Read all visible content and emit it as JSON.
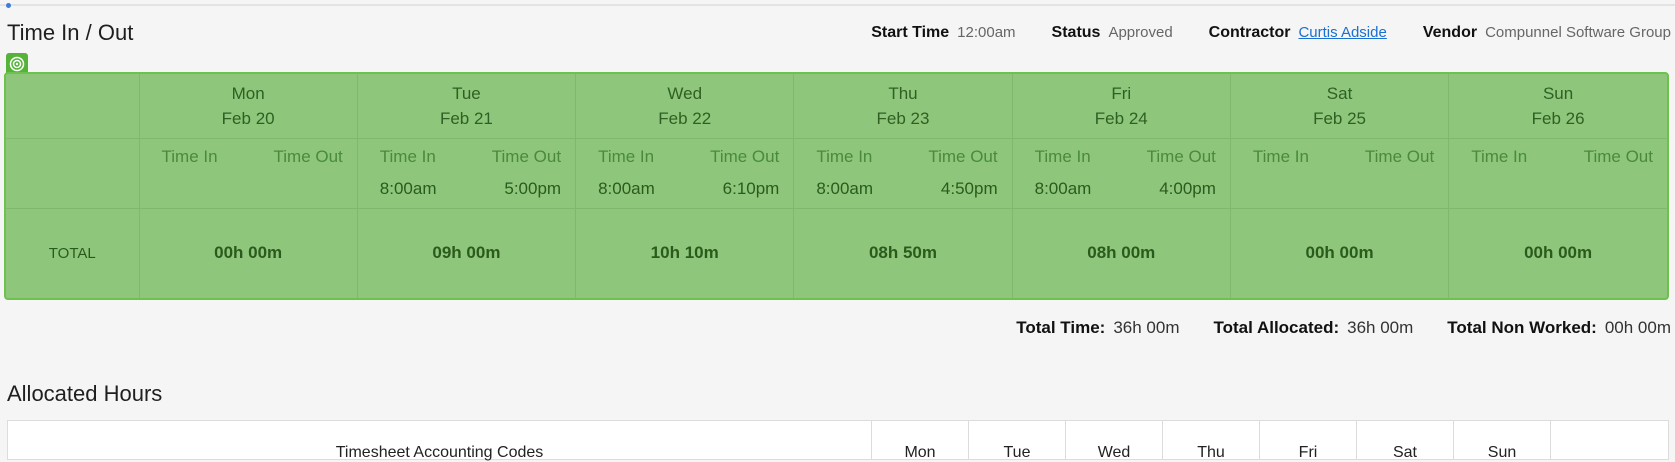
{
  "header": {
    "title": "Time In / Out",
    "meta": [
      {
        "label": "Start Time",
        "value": "12:00am"
      },
      {
        "label": "Status",
        "value": "Approved"
      },
      {
        "label": "Contractor",
        "value": "Curtis Adside"
      },
      {
        "label": "Vendor",
        "value": "Compunnel Software Group"
      }
    ]
  },
  "grid": {
    "time_in_label": "Time In",
    "time_out_label": "Time Out",
    "total_label": "TOTAL",
    "days": [
      {
        "name": "Mon",
        "date": "Feb 20",
        "time_in": "",
        "time_out": "",
        "total": "00h 00m"
      },
      {
        "name": "Tue",
        "date": "Feb 21",
        "time_in": "8:00am",
        "time_out": "5:00pm",
        "total": "09h 00m"
      },
      {
        "name": "Wed",
        "date": "Feb 22",
        "time_in": "8:00am",
        "time_out": "6:10pm",
        "total": "10h 10m"
      },
      {
        "name": "Thu",
        "date": "Feb 23",
        "time_in": "8:00am",
        "time_out": "4:50pm",
        "total": "08h 50m"
      },
      {
        "name": "Fri",
        "date": "Feb 24",
        "time_in": "8:00am",
        "time_out": "4:00pm",
        "total": "08h 00m"
      },
      {
        "name": "Sat",
        "date": "Feb 25",
        "time_in": "",
        "time_out": "",
        "total": "00h 00m"
      },
      {
        "name": "Sun",
        "date": "Feb 26",
        "time_in": "",
        "time_out": "",
        "total": "00h 00m"
      }
    ]
  },
  "totals": [
    {
      "label": "Total Time:",
      "value": "36h 00m"
    },
    {
      "label": "Total Allocated:",
      "value": "36h 00m"
    },
    {
      "label": "Total Non Worked:",
      "value": "00h 00m"
    }
  ],
  "allocated": {
    "title": "Allocated Hours",
    "columns": [
      "Timesheet Accounting Codes",
      "Mon",
      "Tue",
      "Wed",
      "Thu",
      "Fri",
      "Sat",
      "Sun",
      ""
    ]
  },
  "colors": {
    "highlight_fill": "#8ec77c",
    "highlight_border": "#6cc24a",
    "link": "#1a6fd1"
  }
}
